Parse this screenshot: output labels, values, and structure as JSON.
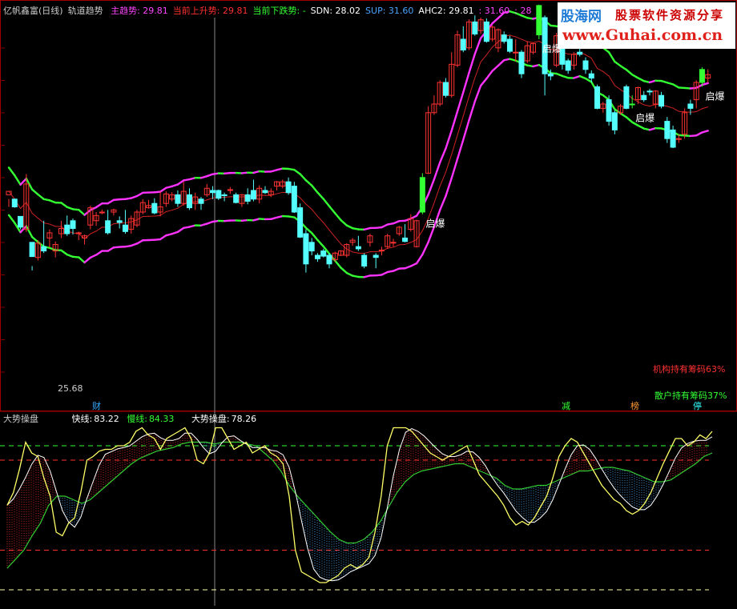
{
  "header": {
    "stock": "亿帆鑫富(日线)",
    "indicator": "轨道趋势",
    "fields": [
      {
        "label": "主趋势",
        "value": "29.81",
        "color": "#ff44ff"
      },
      {
        "label": "当前上升势",
        "value": "29.81",
        "color": "#ff3030"
      },
      {
        "label": "当前下跌势",
        "value": "-",
        "color": "#33ff33"
      },
      {
        "label": "SDN",
        "value": "28.02",
        "color": "#ffffff"
      },
      {
        "label": "SUP",
        "value": "31.60",
        "color": "#4aa3ff"
      },
      {
        "label": "AHC2",
        "value": "29.81",
        "color": "#ffffff"
      },
      {
        "label": "",
        "value": "31.60",
        "color": "#ff44ff"
      },
      {
        "label": "",
        "value": "28",
        "color": "#ff44ff"
      }
    ]
  },
  "logo": {
    "name_cn": "股海网",
    "slogan": "股票软件资源分享",
    "url": "www.Guhai.com.cn"
  },
  "annotations": {
    "breakout_label": "启爆",
    "low_price": "25.68",
    "institution_text": "机构持有筹码63%",
    "retail_text": "散户持有筹码37%",
    "tags": [
      {
        "text": "财",
        "color": "#33aaff"
      },
      {
        "text": "减",
        "color": "#33ff33"
      },
      {
        "text": "榜",
        "color": "#ff9933"
      },
      {
        "text": "停",
        "color": "#33ffff"
      }
    ]
  },
  "sub_header": {
    "title": "大势操盘",
    "fast_label": "快线:",
    "fast_value": "83.22",
    "slow_label": "慢线:",
    "slow_value": "84.33",
    "main_label": "大势操盘:",
    "main_value": "78.26"
  },
  "colors": {
    "up_candle": "#ff3232",
    "down_candle": "#54ffff",
    "breakout_candle": "#33ff33",
    "channel_up": "#ff33ff",
    "channel_down": "#33ff33",
    "mid_line": "#cc2222",
    "fast_line": "#ffff66",
    "slow_line": "#33cc33",
    "grid": "#800000"
  },
  "chart_data": [
    {
      "type": "candlestick",
      "title": "亿帆鑫富(日线) 轨道趋势",
      "ylim": [
        24,
        33
      ],
      "candles": [
        [
          28.9,
          28.98,
          28.62,
          28.8
        ],
        [
          28.8,
          28.62,
          28.7,
          28.6
        ],
        [
          28.4,
          28.15,
          28.1,
          28.2
        ],
        [
          28.1,
          29.15,
          29.38,
          28.04
        ],
        [
          27.8,
          27.47,
          27.25,
          27.15
        ],
        [
          27.45,
          27.78,
          27.85,
          27.38
        ],
        [
          27.7,
          27.6,
          28.3,
          27.55
        ],
        [
          27.9,
          28.02,
          28.1,
          27.68
        ],
        [
          27.6,
          27.75,
          27.82,
          27.45
        ],
        [
          28.0,
          28.12,
          28.3,
          27.9
        ],
        [
          28.2,
          28.0,
          28.42,
          27.95
        ],
        [
          28.3,
          28.12,
          28.35,
          27.98
        ],
        [
          28.0,
          28.02,
          28.05,
          27.85
        ],
        [
          27.9,
          27.95,
          27.98,
          27.75
        ],
        [
          28.2,
          28.6,
          28.65,
          28.1
        ],
        [
          28.3,
          28.42,
          28.5,
          28.18
        ],
        [
          28.5,
          28.5,
          28.56,
          28.45
        ],
        [
          28.3,
          28.02,
          28.55,
          27.98
        ],
        [
          28.5,
          28.55,
          28.58,
          28.42
        ],
        [
          28.3,
          28.26,
          28.4,
          28.12
        ],
        [
          28.2,
          28.05,
          28.55,
          28.0
        ],
        [
          28.1,
          28.35,
          28.42,
          28.0
        ],
        [
          28.2,
          28.5,
          28.55,
          28.15
        ],
        [
          28.5,
          28.72,
          28.8,
          28.45
        ],
        [
          28.6,
          28.65,
          28.78,
          28.58
        ],
        [
          28.7,
          28.48,
          28.82,
          28.45
        ],
        [
          28.5,
          28.62,
          28.98,
          28.4
        ],
        [
          28.7,
          28.92,
          28.98,
          28.62
        ],
        [
          28.8,
          28.9,
          28.96,
          28.75
        ],
        [
          28.9,
          28.7,
          29.0,
          28.62
        ],
        [
          28.7,
          28.98,
          29.2,
          28.65
        ],
        [
          28.9,
          28.6,
          29.05,
          28.55
        ],
        [
          28.7,
          28.85,
          28.95,
          28.55
        ],
        [
          28.8,
          28.7,
          28.85,
          28.55
        ],
        [
          28.9,
          29.05,
          29.15,
          28.85
        ],
        [
          29.0,
          28.95,
          29.1,
          28.8
        ],
        [
          29.0,
          28.82,
          29.02,
          28.78
        ],
        [
          28.9,
          28.88,
          28.95,
          28.75
        ],
        [
          29.0,
          29.02,
          29.08,
          28.92
        ],
        [
          28.9,
          28.72,
          28.95,
          28.7
        ],
        [
          28.7,
          28.9,
          28.92,
          28.62
        ],
        [
          28.9,
          28.75,
          29.05,
          28.68
        ],
        [
          29.0,
          28.8,
          29.25,
          28.75
        ],
        [
          28.8,
          29.05,
          29.12,
          28.7
        ],
        [
          29.0,
          28.95,
          29.1,
          28.92
        ],
        [
          28.9,
          28.98,
          29.05,
          28.85
        ],
        [
          29.1,
          29.2,
          29.22,
          29.0
        ],
        [
          29.1,
          29.2,
          29.25,
          29.05
        ],
        [
          29.2,
          28.95,
          29.3,
          28.9
        ],
        [
          29.1,
          28.5,
          29.2,
          28.48
        ],
        [
          28.6,
          27.92,
          28.7,
          27.9
        ],
        [
          28.0,
          27.3,
          28.1,
          27.1
        ],
        [
          27.8,
          27.6,
          27.9,
          27.5
        ],
        [
          27.5,
          27.42,
          27.55,
          27.35
        ],
        [
          27.6,
          27.48,
          27.65,
          27.45
        ],
        [
          27.5,
          27.3,
          27.55,
          27.2
        ],
        [
          27.4,
          27.55,
          27.58,
          27.35
        ],
        [
          27.5,
          27.6,
          27.62,
          27.48
        ],
        [
          27.5,
          27.75,
          27.78,
          27.45
        ],
        [
          27.8,
          27.85,
          27.9,
          27.72
        ],
        [
          27.7,
          27.65,
          27.95,
          27.6
        ],
        [
          27.5,
          27.25,
          27.55,
          27.2
        ],
        [
          27.8,
          27.95,
          28.0,
          27.7
        ],
        [
          27.5,
          27.45,
          27.55,
          27.2
        ],
        [
          27.6,
          27.62,
          27.7,
          27.5
        ],
        [
          27.7,
          27.95,
          28.0,
          27.65
        ],
        [
          27.8,
          27.8,
          27.88,
          27.7
        ],
        [
          28.0,
          28.15,
          28.18,
          27.95
        ],
        [
          27.9,
          27.82,
          28.22,
          27.8
        ],
        [
          28.1,
          28.35,
          28.45,
          28.05
        ],
        [
          27.7,
          28.3,
          28.32,
          27.68
        ],
        [
          28.5,
          29.3,
          29.4,
          28.45
        ],
        [
          29.4,
          30.8,
          30.95,
          29.38
        ],
        [
          30.8,
          31.0,
          31.2,
          30.75
        ],
        [
          31.0,
          31.5,
          31.55,
          30.95
        ],
        [
          31.5,
          31.2,
          31.6,
          31.15
        ],
        [
          31.2,
          31.92,
          32.2,
          31.15
        ],
        [
          31.9,
          32.6,
          32.7,
          31.85
        ],
        [
          32.5,
          32.25,
          32.8,
          32.2
        ],
        [
          32.3,
          32.9,
          32.96,
          32.25
        ],
        [
          32.9,
          32.62,
          33.05,
          32.58
        ],
        [
          32.7,
          32.95,
          33.0,
          32.62
        ],
        [
          32.9,
          32.45,
          32.98,
          32.42
        ],
        [
          32.5,
          32.78,
          32.82,
          32.45
        ],
        [
          32.3,
          32.72,
          32.75,
          32.2
        ],
        [
          32.6,
          32.45,
          32.68,
          32.4
        ],
        [
          32.5,
          32.22,
          32.58,
          32.18
        ],
        [
          32.2,
          32.2,
          32.5,
          31.98
        ],
        [
          32.2,
          31.7,
          32.25,
          31.6
        ],
        [
          32.0,
          32.35,
          32.45,
          31.95
        ],
        [
          32.2,
          32.4,
          32.42,
          32.15
        ],
        [
          32.6,
          33.28,
          33.3,
          32.5
        ],
        [
          33.0,
          31.7,
          33.05,
          31.2
        ],
        [
          31.7,
          31.65,
          31.8,
          31.55
        ],
        [
          31.9,
          32.58,
          32.65,
          31.85
        ],
        [
          32.4,
          31.92,
          32.48,
          31.8
        ],
        [
          32.0,
          31.78,
          32.05,
          31.7
        ],
        [
          31.9,
          32.15,
          32.2,
          31.8
        ],
        [
          32.2,
          32.15,
          32.3,
          32.1
        ],
        [
          32.0,
          31.8,
          32.08,
          31.7
        ],
        [
          31.7,
          31.6,
          31.78,
          31.5
        ],
        [
          31.4,
          30.9,
          31.45,
          30.88
        ],
        [
          30.9,
          31.0,
          31.05,
          30.8
        ],
        [
          31.1,
          30.6,
          31.2,
          30.5
        ],
        [
          30.8,
          30.4,
          30.85,
          30.3
        ],
        [
          30.8,
          30.95,
          31.0,
          30.75
        ],
        [
          31.4,
          30.9,
          31.45,
          30.88
        ],
        [
          31.0,
          31.0,
          31.2,
          30.9
        ],
        [
          31.1,
          31.38,
          31.4,
          31.0
        ],
        [
          31.2,
          31.1,
          31.3,
          31.05
        ],
        [
          31.3,
          31.28,
          31.35,
          31.2
        ],
        [
          31.0,
          31.3,
          31.32,
          30.9
        ],
        [
          31.2,
          30.95,
          31.28,
          30.9
        ],
        [
          30.6,
          30.2,
          30.7,
          30.1
        ],
        [
          30.4,
          30.0,
          30.5,
          29.98
        ],
        [
          30.2,
          30.2,
          30.3,
          30.1
        ],
        [
          30.3,
          30.8,
          30.9,
          30.2
        ],
        [
          31.0,
          30.9,
          31.1,
          30.75
        ],
        [
          31.1,
          31.5,
          31.55,
          30.9
        ],
        [
          31.5,
          31.8,
          31.85,
          31.4
        ],
        [
          31.6,
          31.68,
          31.8,
          31.5
        ]
      ],
      "annotation_points": [
        {
          "label": "启爆",
          "index": 71
        },
        {
          "label": "启爆",
          "index": 91
        },
        {
          "label": "启爆",
          "index": 107
        },
        {
          "label": "启爆",
          "index": 119
        },
        {
          "label": "25.68",
          "index": 8
        }
      ]
    },
    {
      "type": "line",
      "title": "大势操盘",
      "ylim": [
        0,
        100
      ],
      "ref_levels": [
        8,
        30,
        80,
        88
      ],
      "series": [
        {
          "name": "快线",
          "values": [
            55,
            62,
            75,
            90,
            84,
            82,
            70,
            60,
            40,
            38,
            45,
            48,
            62,
            80,
            82,
            85,
            86,
            86,
            88,
            88,
            90,
            96,
            98,
            94,
            92,
            86,
            92,
            94,
            96,
            98,
            92,
            80,
            78,
            84,
            98,
            98,
            92,
            86,
            88,
            90,
            84,
            86,
            88,
            84,
            82,
            78,
            60,
            30,
            18,
            16,
            14,
            12,
            12,
            14,
            16,
            20,
            22,
            20,
            22,
            26,
            40,
            60,
            88,
            98,
            98,
            98,
            96,
            92,
            88,
            84,
            82,
            80,
            82,
            84,
            86,
            88,
            80,
            72,
            68,
            64,
            60,
            55,
            48,
            44,
            46,
            44,
            48,
            54,
            60,
            70,
            82,
            88,
            92,
            90,
            84,
            78,
            72,
            66,
            62,
            58,
            56,
            52,
            50,
            52,
            56,
            62,
            70,
            78,
            85,
            92,
            92,
            88,
            90,
            94,
            92,
            96
          ]
        },
        {
          "name": "慢线",
          "values": [
            20,
            25,
            30,
            38,
            45,
            55,
            60,
            60,
            58,
            56,
            58,
            62,
            66,
            70,
            74,
            78,
            81,
            83,
            85,
            86,
            87,
            89,
            90,
            90,
            90,
            89,
            90,
            90,
            90,
            89,
            88,
            84,
            80,
            74,
            66,
            60,
            55,
            50,
            45,
            40,
            36,
            34,
            34,
            36,
            40,
            46,
            54,
            62,
            68,
            72,
            74,
            75,
            76,
            77,
            78,
            78,
            76,
            74,
            72,
            70,
            66,
            64,
            64,
            65,
            66,
            66,
            68,
            70,
            72,
            74,
            74,
            75,
            76,
            76,
            75,
            74,
            72,
            70,
            68,
            68,
            69,
            72,
            75,
            78,
            82,
            84
          ]
        }
      ]
    }
  ]
}
